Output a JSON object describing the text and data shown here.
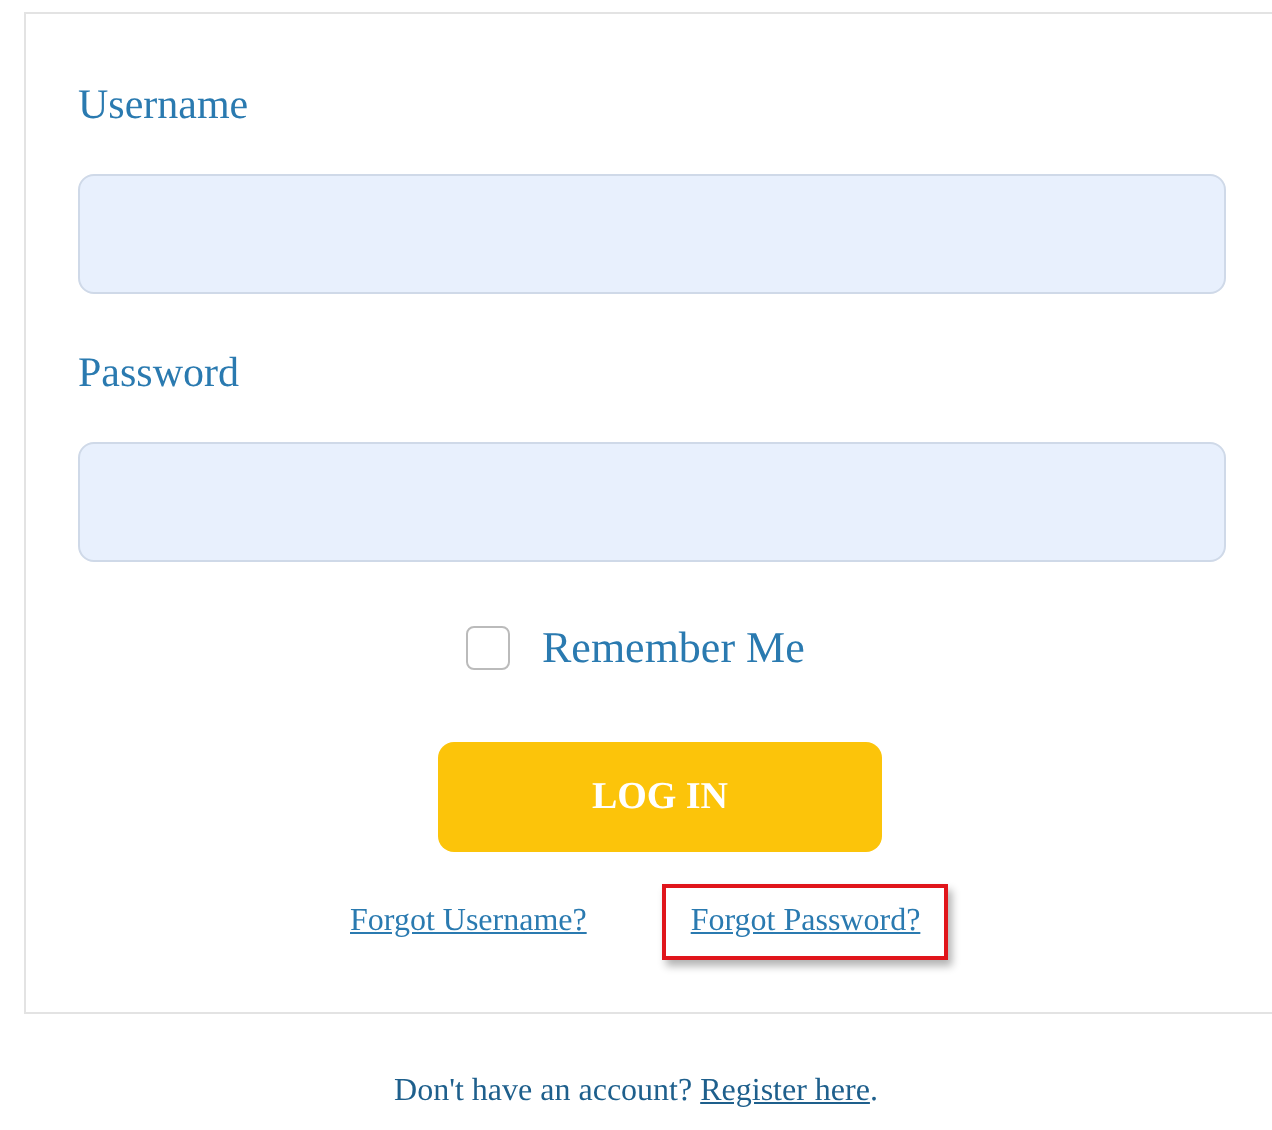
{
  "fields": [
    {
      "label": "Username"
    },
    {
      "label": "Password"
    }
  ],
  "remember": {
    "label": "Remember Me",
    "checked": false
  },
  "login_button": "LOG IN",
  "links": [
    {
      "label": "Forgot Username?",
      "highlighted": false
    },
    {
      "label": "Forgot Password?",
      "highlighted": true
    }
  ],
  "footer": {
    "text": "Don't have an account?",
    "link": "Register here",
    "end": "."
  }
}
